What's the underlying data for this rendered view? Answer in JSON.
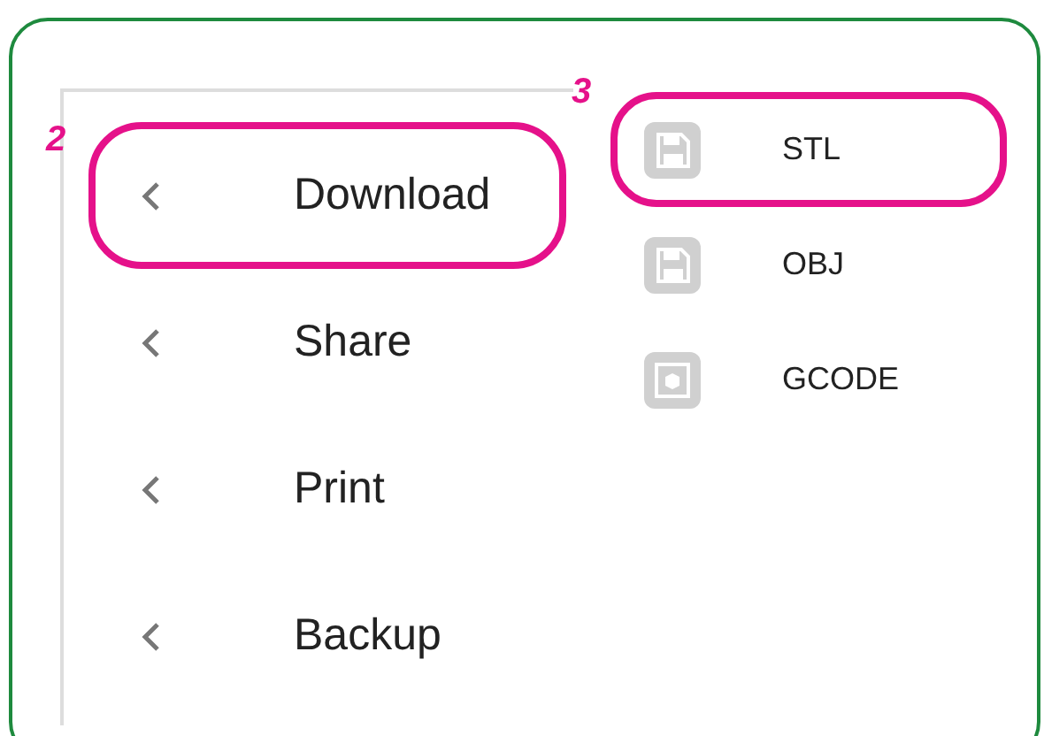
{
  "menu": {
    "items": [
      {
        "label": "Download",
        "highlighted": true,
        "callout": "2"
      },
      {
        "label": "Share",
        "highlighted": false
      },
      {
        "label": "Print",
        "highlighted": false
      },
      {
        "label": "Backup",
        "highlighted": false
      }
    ]
  },
  "submenu": {
    "items": [
      {
        "label": "STL",
        "kind": "floppy",
        "highlighted": true,
        "callout": "3"
      },
      {
        "label": "OBJ",
        "kind": "floppy",
        "highlighted": false
      },
      {
        "label": "GCODE",
        "kind": "printer",
        "highlighted": false
      }
    ]
  }
}
